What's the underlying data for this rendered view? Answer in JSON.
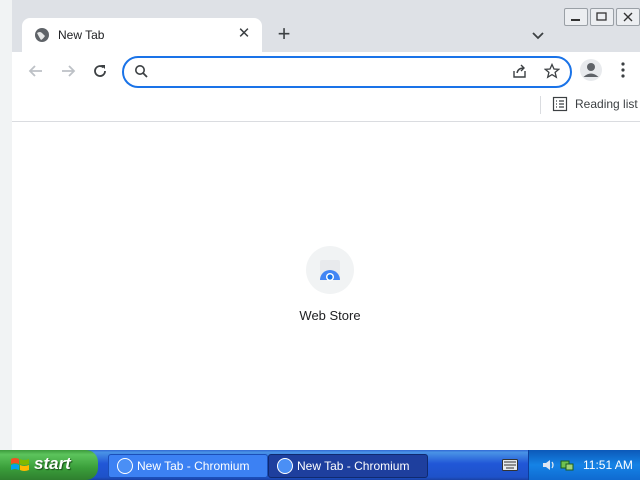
{
  "browser": {
    "tab": {
      "title": "New Tab",
      "favicon": "globe-icon",
      "close_icon": "close-icon"
    },
    "new_tab_icon": "plus-icon",
    "tab_search_icon": "chevron-down-icon",
    "omnibox": {
      "value": "",
      "placeholder": ""
    },
    "reading_list_label": "Reading list",
    "accent_color": "#1a73e8"
  },
  "shortcuts": [
    {
      "label": "Web Store",
      "icon": "web-store-icon"
    }
  ],
  "taskbar": {
    "start_label": "start",
    "tasks": [
      {
        "label": "New Tab - Chromium",
        "active": false
      },
      {
        "label": "New Tab - Chromium",
        "active": true
      }
    ],
    "clock": "11:51 AM"
  }
}
